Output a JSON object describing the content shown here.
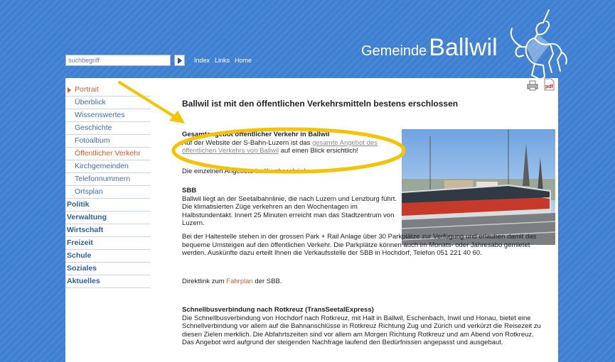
{
  "search": {
    "placeholder": "suchbegriff"
  },
  "top_nav": [
    "Index",
    "Links",
    "Home"
  ],
  "brand": {
    "prefix": "Gemeinde",
    "name": "Ballwil"
  },
  "sidebar": {
    "items": [
      {
        "label": "Portrait",
        "state": "active"
      },
      {
        "label": "Überblick"
      },
      {
        "label": "Wissenswertes"
      },
      {
        "label": "Geschichte"
      },
      {
        "label": "Fotoalbum"
      },
      {
        "label": "Öffentlicher Verkehr",
        "state": "current"
      },
      {
        "label": "Kirchgemeinden"
      },
      {
        "label": "Telefonnummern"
      },
      {
        "label": "Ortsplan"
      },
      {
        "label": "Politik",
        "major": true
      },
      {
        "label": "Verwaltung",
        "major": true
      },
      {
        "label": "Wirtschaft",
        "major": true
      },
      {
        "label": "Freizeit",
        "major": true
      },
      {
        "label": "Schule",
        "major": true
      },
      {
        "label": "Soziales",
        "major": true
      },
      {
        "label": "Aktuelles",
        "major": true
      }
    ]
  },
  "page": {
    "title": "Ballwil ist mit den öffentlichen Verkehrsmitteln bestens erschlossen",
    "intro_heading": "Gesamtangebot öffentlicher Verkehr in Ballwil",
    "intro_text_before": "Auf der Website der S-Bahn-Luzern ist das ",
    "intro_link": "gesamte Angebot des öffentlichen Verkehrs von Ballwil",
    "intro_text_after": " auf einen Blick ersichtlich!",
    "overview_line": "Die einzelnen Angebote im Kurzbeschrieb:",
    "sbb_heading": "SBB",
    "sbb_text": "Ballwil liegt an der Seetalbahnlinie, die nach Luzern und Lenzburg führt. Die klimatisierten Züge verkehren an den Wochentagen im Halbstundentakt. Innert 25 Minuten erreicht man das Stadtzentrum von Luzern.",
    "sbb_text2": "Bei der Haltestelle stehen in der grossen Park + Rail Anlage über 30 Parkplätze zur Verfügung und erlauben damit das bequeme Umsteigen auf den öffentlichen Verkehr. Die Parkplätze können auch im Monats- oder Jahresabo gemietet werden. Auskünfte dazu erteilt Ihnen die Verkaufsstelle der SBB in Hochdorf, Telefon 051 221 40 60.",
    "direct_before": "Direktlink zum ",
    "direct_link": "Fahrplan",
    "direct_after": " der SBB.",
    "bus_heading": "Schnellbusverbindung nach Rotkreuz (TransSeetalExpress)",
    "bus_text": "Die Schnellbusverbindung von Hochdorf nach Rotkreuz, mit Halt in Ballwil, Eschenbach, Inwil und Honau, bietet eine Schnellverbindung vor allem auf die Bahnanschlüsse in Rotkreuz Richtung Zug und Zürich und verkürzt die Reisezeit zu diesen Zielen merklich. Die Abfahrtszeiten sind vor allem am Morgen Richtung Rotkreuz und am Abend von Rotkreuz. Das Angebot wird aufgrund der steigenden Nachfrage laufend den Bedürfnissen angepasst und ausgebaut."
  },
  "icons": {
    "print": "printer-icon",
    "pdf": "pdf-icon",
    "logo": "unicorn-icon",
    "search_go": "arrow-right-icon"
  },
  "colors": {
    "background": "#3f80d2",
    "accent": "#e05a28",
    "nav": "#3f6cb4",
    "highlight": "#f7c300"
  }
}
